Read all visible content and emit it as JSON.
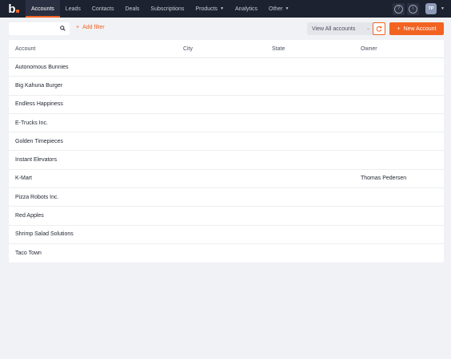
{
  "brand": {
    "logo_text": "b",
    "accent": "#f26322",
    "nav_bg": "#1d2230"
  },
  "nav": {
    "items": [
      {
        "label": "Accounts",
        "active": true
      },
      {
        "label": "Leads"
      },
      {
        "label": "Contacts"
      },
      {
        "label": "Deals"
      },
      {
        "label": "Subscriptions"
      },
      {
        "label": "Products",
        "dropdown": true
      },
      {
        "label": "Analytics"
      },
      {
        "label": "Other",
        "dropdown": true
      }
    ],
    "help_icon": "question-circle-icon",
    "info_icon": "info-circle-icon",
    "user_initials": "TP"
  },
  "toolbar": {
    "search_placeholder": "",
    "add_filter_label": "Add filter",
    "view_selector_value": "View All accounts",
    "new_button_label": "New Account"
  },
  "table": {
    "headers": [
      "Account",
      "City",
      "State",
      "Owner"
    ],
    "rows": [
      [
        "Autonomous Bunnies",
        "",
        "",
        ""
      ],
      [
        "Big Kahuna Burger",
        "",
        "",
        ""
      ],
      [
        "Endless Happiness",
        "",
        "",
        ""
      ],
      [
        "E-Trucks Inc.",
        "",
        "",
        ""
      ],
      [
        "Golden Timepieces",
        "",
        "",
        ""
      ],
      [
        "Instant Elevators",
        "",
        "",
        ""
      ],
      [
        "K-Mart",
        "",
        "",
        "Thomas Pedersen"
      ],
      [
        "Pizza Robots Inc.",
        "",
        "",
        ""
      ],
      [
        "Red Apples",
        "",
        "",
        ""
      ],
      [
        "Shrimp Salad Solutions",
        "",
        "",
        ""
      ],
      [
        "Taco Town",
        "",
        "",
        ""
      ]
    ]
  }
}
